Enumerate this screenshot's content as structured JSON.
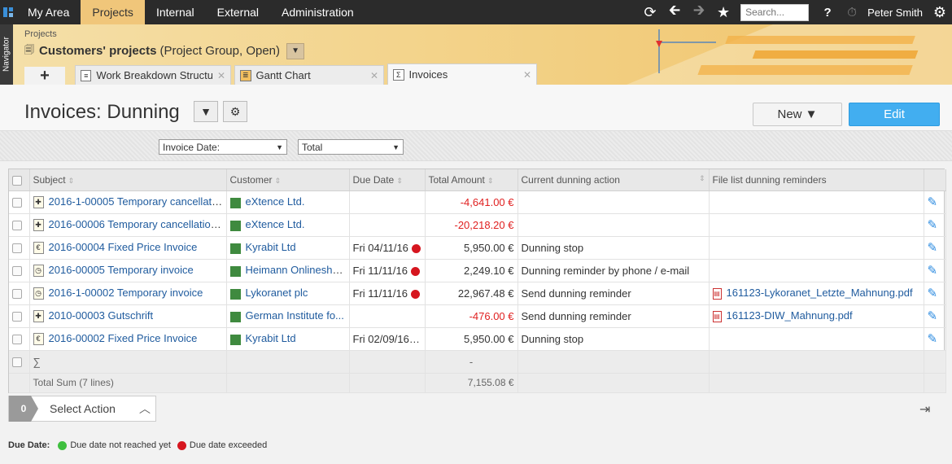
{
  "topnav": {
    "tabs": [
      "My Area",
      "Projects",
      "Internal",
      "External",
      "Administration"
    ],
    "active_tab": "Projects",
    "search_placeholder": "Search...",
    "user_name": "Peter Smith"
  },
  "navigator_label": "Navigator",
  "breadcrumb": "Projects",
  "project": {
    "title": "Customers' projects",
    "subtitle": "(Project Group, Open)"
  },
  "subtabs": [
    {
      "label": "Work Breakdown Structure"
    },
    {
      "label": "Gantt Chart"
    },
    {
      "label": "Invoices"
    }
  ],
  "page_title": "Invoices: Dunning",
  "buttons": {
    "new": "New",
    "edit": "Edit"
  },
  "filters": {
    "date_field": "Invoice Date:",
    "range": "Total"
  },
  "columns": [
    "Subject",
    "Customer",
    "Due Date",
    "Total Amount",
    "Current dunning action",
    "File list dunning reminders"
  ],
  "rows": [
    {
      "subject": "2016-1-00005 Temporary cancellati...",
      "customer": "eXtence Ltd.",
      "due": "",
      "amount": "-4,641.00 €",
      "action": "",
      "file": ""
    },
    {
      "subject": "2016-00006 Temporary cancellation...",
      "customer": "eXtence Ltd.",
      "due": "",
      "amount": "-20,218.20 €",
      "action": "",
      "file": ""
    },
    {
      "subject": "2016-00004 Fixed Price Invoice",
      "customer": "Kyrabit Ltd",
      "due": "Fri 04/11/16",
      "amount": "5,950.00 €",
      "action": "Dunning stop",
      "file": ""
    },
    {
      "subject": "2016-00005 Temporary invoice",
      "customer": "Heimann Onlinesho...",
      "due": "Fri 11/11/16",
      "amount": "2,249.10 €",
      "action": "Dunning reminder by phone / e-mail",
      "file": ""
    },
    {
      "subject": "2016-1-00002 Temporary invoice",
      "customer": "Lykoranet plc",
      "due": "Fri 11/11/16",
      "amount": "22,967.48 €",
      "action": "Send dunning reminder",
      "file": "161123-Lykoranet_Letzte_Mahnung.pdf"
    },
    {
      "subject": "2010-00003 Gutschrift",
      "customer": "German Institute fo...",
      "due": "",
      "amount": "-476.00 €",
      "action": "Send dunning reminder",
      "file": "161123-DIW_Mahnung.pdf"
    },
    {
      "subject": "2016-00002 Fixed Price Invoice",
      "customer": "Kyrabit Ltd",
      "due": "Fri 02/09/16",
      "amount": "5,950.00 €",
      "action": "Dunning stop",
      "file": ""
    }
  ],
  "sum_row": {
    "symbol": "∑",
    "amount": "-"
  },
  "total_row": {
    "label": "Total Sum (7 lines)",
    "amount": "7,155.08 €"
  },
  "action_bar": {
    "count": "0",
    "label": "Select Action"
  },
  "legend": {
    "title": "Due Date:",
    "not_reached": "Due date not reached yet",
    "exceeded": "Due date exceeded"
  },
  "colors": {
    "accent_blue": "#42aef0",
    "exceeded_red": "#d6161f",
    "not_reached_green": "#3fbf3f",
    "negative_red": "#e02020"
  }
}
